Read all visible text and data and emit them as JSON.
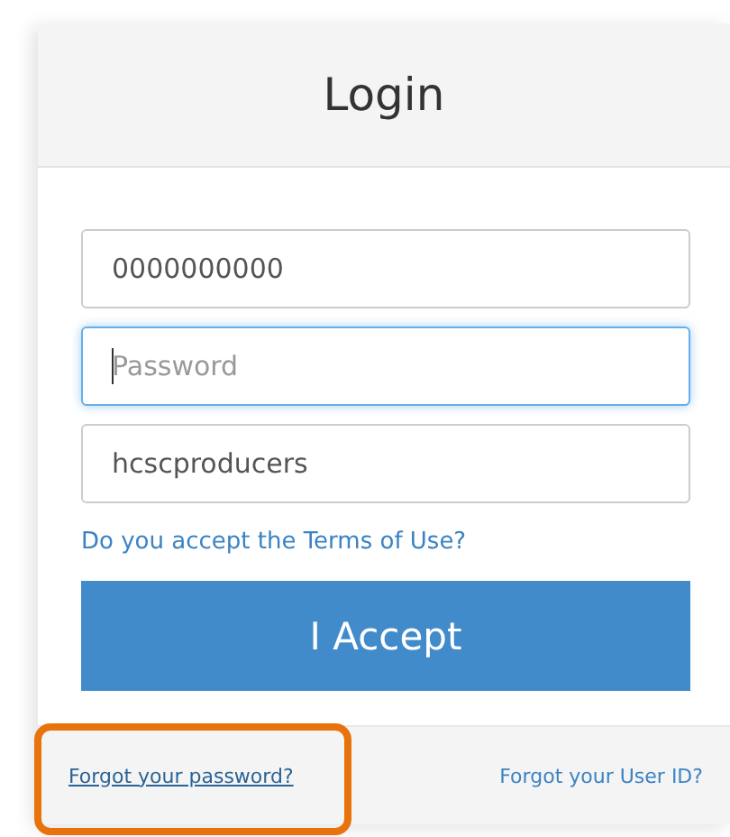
{
  "header": {
    "title": "Login"
  },
  "fields": [
    {
      "kind": "text",
      "value": "0000000000",
      "focused": false
    },
    {
      "kind": "password",
      "placeholder": "Password",
      "focused": true
    },
    {
      "kind": "text",
      "value": "hcscproducers",
      "focused": false
    }
  ],
  "terms_link": "Do you accept the Terms of Use?",
  "accept_button": "I Accept",
  "footer": {
    "links": [
      {
        "label": "Forgot your password?",
        "underlined": true,
        "highlighted": true
      },
      {
        "label": "Forgot your User ID?",
        "underlined": false,
        "highlighted": false
      }
    ]
  }
}
